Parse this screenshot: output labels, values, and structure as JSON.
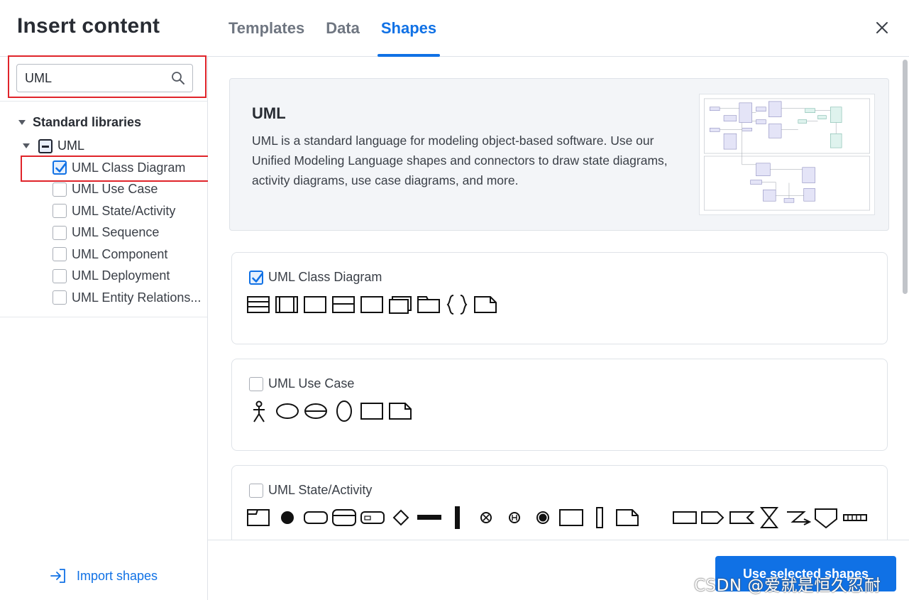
{
  "header": {
    "title": "Insert content",
    "tabs": [
      {
        "label": "Templates",
        "active": false
      },
      {
        "label": "Data",
        "active": false
      },
      {
        "label": "Shapes",
        "active": true
      }
    ],
    "close_icon": "close-icon"
  },
  "sidebar": {
    "search": {
      "value": "UML",
      "placeholder": "",
      "icon": "search-icon"
    },
    "section_label": "Standard libraries",
    "root": {
      "label": "UML",
      "state": "indeterminate"
    },
    "items": [
      {
        "label": "UML Class Diagram",
        "checked": true
      },
      {
        "label": "UML Use Case",
        "checked": false
      },
      {
        "label": "UML State/Activity",
        "checked": false
      },
      {
        "label": "UML Sequence",
        "checked": false
      },
      {
        "label": "UML Component",
        "checked": false
      },
      {
        "label": "UML Deployment",
        "checked": false
      },
      {
        "label": "UML Entity Relations...",
        "checked": false
      }
    ],
    "import_label": "Import shapes"
  },
  "main": {
    "info": {
      "title": "UML",
      "description": "UML is a standard language for modeling object-based software. Use our Unified Modeling Language shapes and connectors to draw state diagrams, activity diagrams, use case diagrams, and more."
    },
    "libraries": [
      {
        "label": "UML Class Diagram",
        "checked": true
      },
      {
        "label": "UML Use Case",
        "checked": false
      },
      {
        "label": "UML State/Activity",
        "checked": false
      }
    ]
  },
  "footer": {
    "primary_label": "Use selected shapes"
  },
  "watermark": "CSDN @爱就是恒久忍耐",
  "colors": {
    "accent": "#1071e5",
    "highlight_outline": "#e0242a",
    "text": "#282c33",
    "muted_tab": "#6f7681",
    "card_bg": "#f3f5f8",
    "border": "#dfe3e8"
  }
}
